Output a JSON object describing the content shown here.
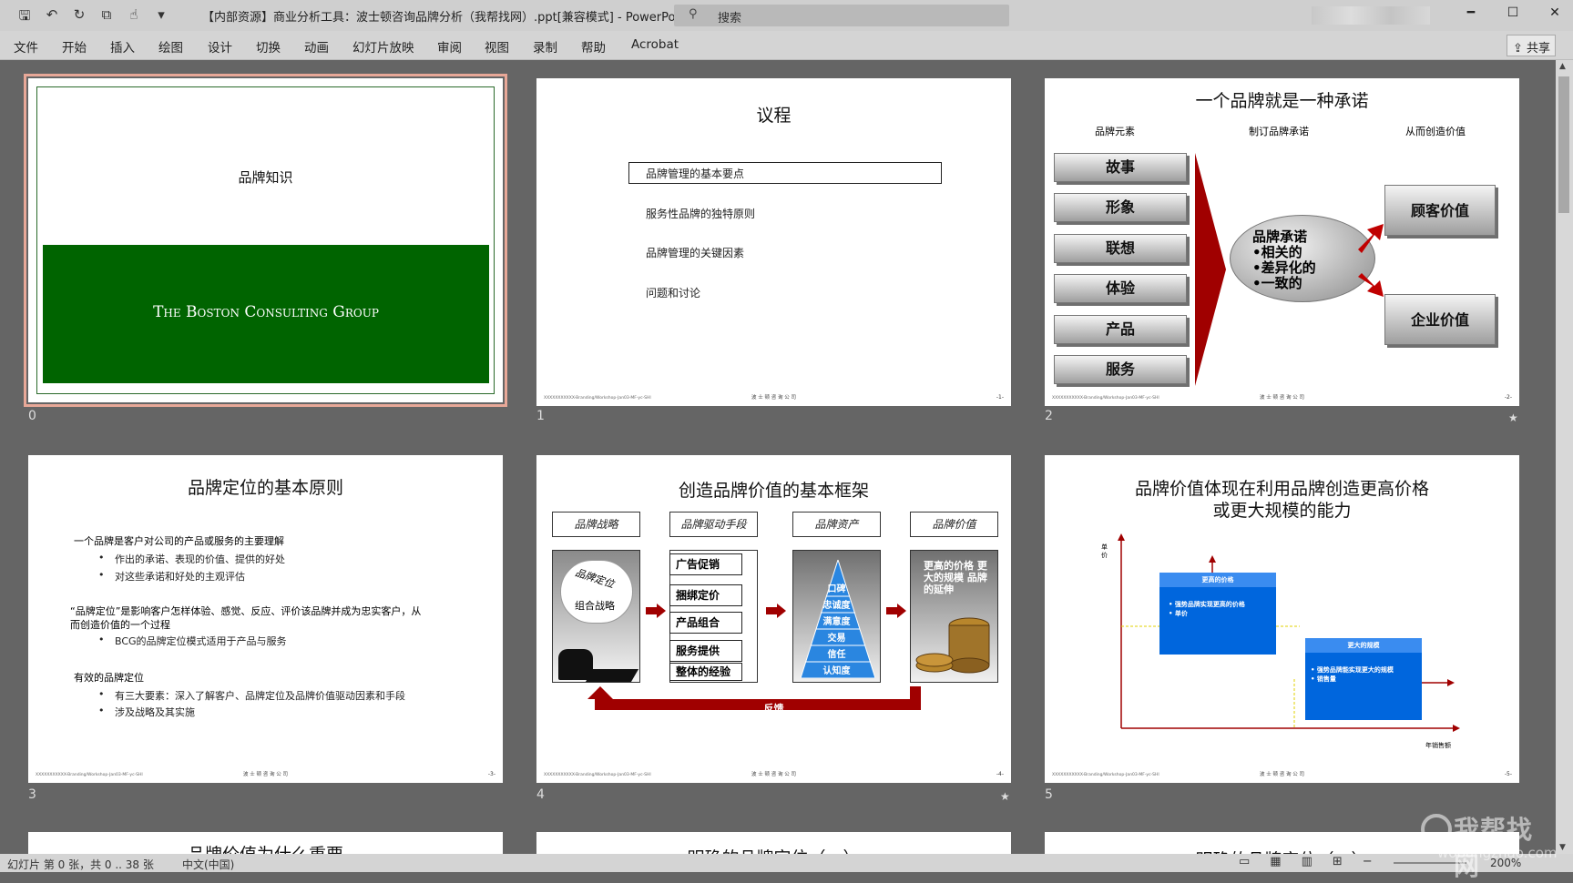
{
  "window": {
    "title": "【内部资源】商业分析工具：波士顿咨询品牌分析（我帮找网）.ppt[兼容模式] - PowerPoint",
    "search_placeholder": "搜索",
    "buttons": [
      "━",
      "☐",
      "✕"
    ]
  },
  "ribbon": {
    "tabs": [
      "文件",
      "开始",
      "插入",
      "绘图",
      "设计",
      "切换",
      "动画",
      "幻灯片放映",
      "审阅",
      "视图",
      "录制",
      "帮助",
      "Acrobat"
    ],
    "share": "共享"
  },
  "slides": [
    {
      "number": "0",
      "title": "品牌知识",
      "banner": "The Boston Consulting Group"
    },
    {
      "number": "1",
      "title": "议程",
      "items": [
        "品牌管理的基本要点",
        "服务性品牌的独特原则",
        "品牌管理的关键因素",
        "问题和讨论"
      ],
      "footer_l": "XXXXXXXXXXX-Branding/Workshop-Jan03-MF-yc-SHI",
      "footer_c": "波 士 顿 咨 询 公 司",
      "footer_r": "-1-"
    },
    {
      "number": "2",
      "title": "一个品牌就是一种承诺",
      "col_heads": [
        "品牌元素",
        "制订品牌承诺",
        "从而创造价值"
      ],
      "elements": [
        "故事",
        "形象",
        "联想",
        "体验",
        "产品",
        "服务"
      ],
      "promise": [
        "品牌承诺",
        "•相关的",
        "•差异化的",
        "•一致的"
      ],
      "values": [
        "顾客价值",
        "企业价值"
      ],
      "footer_l": "XXXXXXXXXXX-Branding/Workshop-Jan03-MF-yc-SHI",
      "footer_c": "波 士 顿 咨 询 公 司",
      "footer_r": "-2-"
    },
    {
      "number": "3",
      "title": "品牌定位的基本原则",
      "lines": [
        "一个品牌是客户对公司的产品或服务的主要理解",
        "作出的承诺、表现的价值、提供的好处",
        "对这些承诺和好处的主观评估",
        "“品牌定位”是影响客户怎样体验、感觉、反应、评价该品牌并成为忠实客户，从",
        "而创造价值的一个过程",
        "BCG的品牌定位模式适用于产品与服务",
        "有效的品牌定位",
        "有三大要素：深入了解客户、品牌定位及品牌价值驱动因素和手段",
        "涉及战略及其实施"
      ],
      "footer_l": "XXXXXXXXXXX-Branding/Workshop-Jan03-MF-yc-SHI",
      "footer_c": "波 士 顿 咨 询 公 司",
      "footer_r": "-3-"
    },
    {
      "number": "4",
      "title": "创造品牌价值的基本框架",
      "heads": [
        "品牌战略",
        "品牌驱动手段",
        "品牌资产",
        "品牌价值"
      ],
      "cloud": [
        "品牌定位",
        "组合战略"
      ],
      "drivers": [
        "广告促销",
        "捆绑定价",
        "产品组合",
        "服务提供",
        "整体的经验"
      ],
      "pyramid": [
        "口碑",
        "忠诚度",
        "满意度",
        "交易",
        "信任",
        "认知度"
      ],
      "value_text": "更高的价格 更大的规模 品牌的延伸",
      "feedback": "反馈",
      "footer_l": "XXXXXXXXXXX-Branding/Workshop-Jan03-MF-yc-SHI",
      "footer_c": "波 士 顿 咨 询 公 司",
      "footer_r": "-4-"
    },
    {
      "number": "5",
      "title_1": "品牌价值体现在利用品牌创造更高价格",
      "title_2": "或更大规模的能力",
      "ylabel": "单价",
      "xlabel": "年销售额",
      "box1_title": "更高的价格",
      "box1_items": [
        "• 强势品牌实现更高的价格",
        "• 单价"
      ],
      "box2_title": "更大的规模",
      "box2_items": [
        "• 强势品牌能实现更大的规模",
        "• 销售量"
      ],
      "footer_l": "XXXXXXXXXXX-Branding/Workshop-Jan03-MF-yc-SHI",
      "footer_c": "波 士 顿 咨 询 公 司",
      "footer_r": "-5-"
    },
    {
      "title": "品牌价值为什么重要"
    },
    {
      "title": "明确的品牌定位（一）"
    },
    {
      "title": "明确的品牌定位（二）"
    }
  ],
  "status": {
    "slide": "幻灯片 第 0 张，共 0 .. 38 张",
    "language": "中文(中国)",
    "zoom": "200%"
  },
  "watermark": {
    "big": "我帮找网",
    "small": "wobangzhao.com"
  },
  "colors": {
    "bcg_green": "#006400",
    "dark_red": "#a00000",
    "blue": "#0070dd"
  }
}
